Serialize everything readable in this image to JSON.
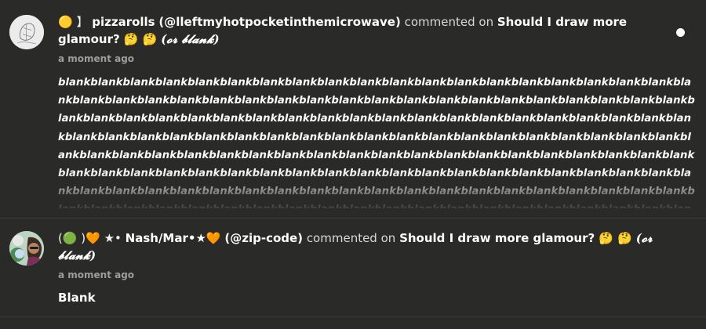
{
  "notifications": [
    {
      "user_prefix": "🟡 】",
      "username": "pizzarolls",
      "handle": "(@lleftmyhotpocketinthemicrowave)",
      "action": "commented on",
      "post_title": "Should I draw more glamour? 🤔 🤔",
      "post_title_fancy": "(𝓸𝓻 𝓫𝓵𝓪𝓷𝓴)",
      "timestamp": "a moment ago",
      "body": "blankblankblankblankblankblankblankblankblankblankblankblankblankblankblankblankblankblankblankblankblankblankblankblankblankblankblankblankblankblankblankblankblankblankblankblankblankblankblankblankblankblankblankblankblankblankblankblankblankblankblankblankblankblankblankblankblankblankblankblankblankblankblankblankblankblankblankblankblankblankblankblankblankblankblankblankblankblankblankblankblankblankblankblankblankblankblankblankblankblankblankblankblankblankblankblankblankblankblankblankblankblankblankblankblankblankblankblankblankblankblankblankblankblankblankblankblankblankblankblankblankblankblankblankblankblankblankblankblankblankblankblankblankblankblankblankblankblankblankblankblankblankblankblankblankblankblankblankblankblankblankblankblankblankblankblankblankblankblankblankblankblankblankblankblankblankblankblankblankblankblankblankblankblankblankblankblankblankblankblankblankblankblankblankblankblankblankblankblankblankblankblankblankblankblankblankblankblankblankblankblankblankblankblankblankblankblank",
      "unread": true
    },
    {
      "user_prefix": "(🟢 )🧡 ★•",
      "username": "Nash/Mar•★🧡",
      "handle": "(@zip-code)",
      "action": "commented on",
      "post_title": "Should I draw more glamour? 🤔 🤔",
      "post_title_fancy": "(𝓸𝓻 𝓫𝓵𝓪𝓷𝓴)",
      "timestamp": "a moment ago",
      "body": "Blank",
      "unread": false
    }
  ],
  "colors": {
    "background": "#2a2a28",
    "divider": "#3b3b39",
    "text": "#ffffff",
    "muted": "#9d9d9b",
    "unread_dot": "#ffffff"
  }
}
